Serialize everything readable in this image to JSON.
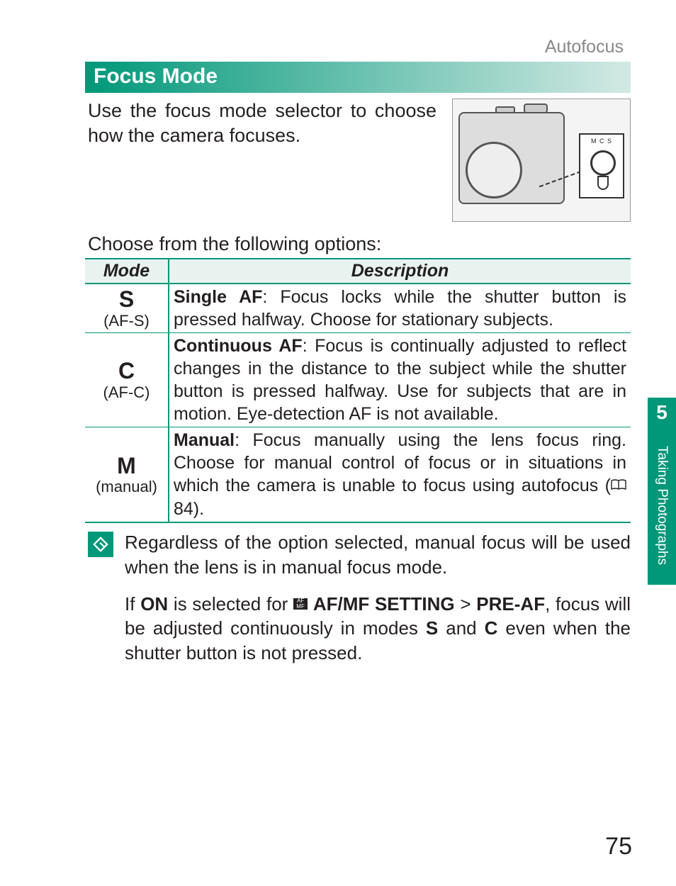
{
  "breadcrumb": "Autofocus",
  "section_title": "Focus Mode",
  "intro": "Use the focus mode selector to choose how the camera focuses.",
  "subhead": "Choose from the following options:",
  "table": {
    "headers": {
      "mode": "Mode",
      "desc": "Description"
    },
    "rows": [
      {
        "letter": "S",
        "sub": "(AF-S)",
        "bold": "Single AF",
        "text": ": Focus locks while the shutter button is pressed halfway.  Choose for stationary subjects."
      },
      {
        "letter": "C",
        "sub": "(AF-C)",
        "bold": "Continuous AF",
        "text": ": Focus is continually adjusted to reflect changes in the distance to the subject while the shutter button is pressed halfway.  Use for subjects that are in motion.  Eye-detection AF is not available."
      },
      {
        "letter": "M",
        "sub": "(manual)",
        "bold": "Manual",
        "text_pre": ": Focus manually using the lens focus ring.  Choose for manual control of focus or in situations in which the camera is unable to focus using autofocus (",
        "page_ref": " 84).",
        "text": ""
      }
    ]
  },
  "notes": {
    "p1": "Regardless of the option selected, manual focus will be used when the lens is in manual focus mode.",
    "p2_pre": "If ",
    "p2_on": "ON",
    "p2_mid1": " is selected for ",
    "p2_setting": "AF/MF SETTING",
    "p2_gt": " > ",
    "p2_preaf": "PRE-AF",
    "p2_mid2": ", focus will be adjusted continuously in modes ",
    "p2_s": "S",
    "p2_and": " and ",
    "p2_c": "C",
    "p2_end": " even when the shutter button is not pressed."
  },
  "inset_label": "M C S",
  "side": {
    "num": "5",
    "label": "Taking Photographs"
  },
  "page_number": "75"
}
